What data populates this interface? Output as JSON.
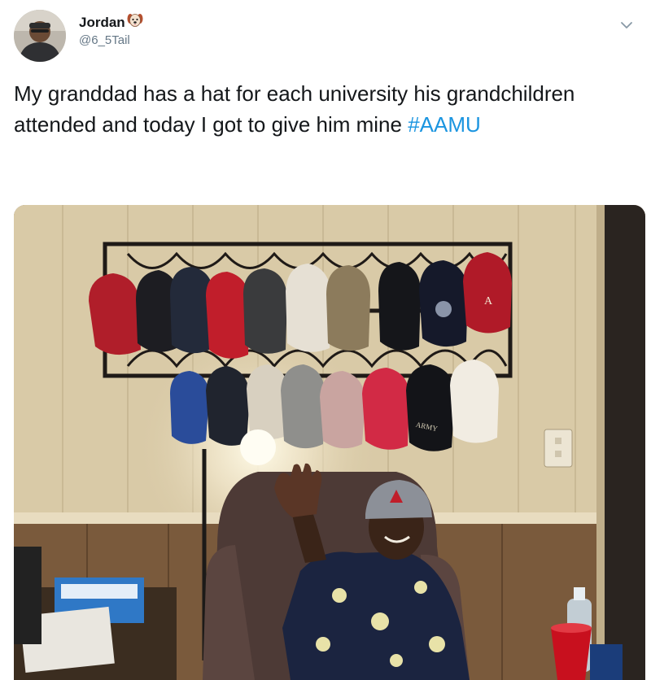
{
  "user": {
    "display_name": "Jordan",
    "emoji_icon": "dog-face-emoji-icon",
    "handle": "@6_5Tail"
  },
  "tweet": {
    "text_main": "My granddad has a hat for each university his grandchildren attended and today I got to give him mine ",
    "hashtag": "#AAMU"
  },
  "menu": {
    "icon": "chevron-down-icon"
  },
  "photo": {
    "cap_texts": [
      "ARMY"
    ],
    "subject": "man-waving-in-recliner"
  },
  "colors": {
    "text": "#14171a",
    "secondary": "#657786",
    "link": "#1b95e0"
  }
}
